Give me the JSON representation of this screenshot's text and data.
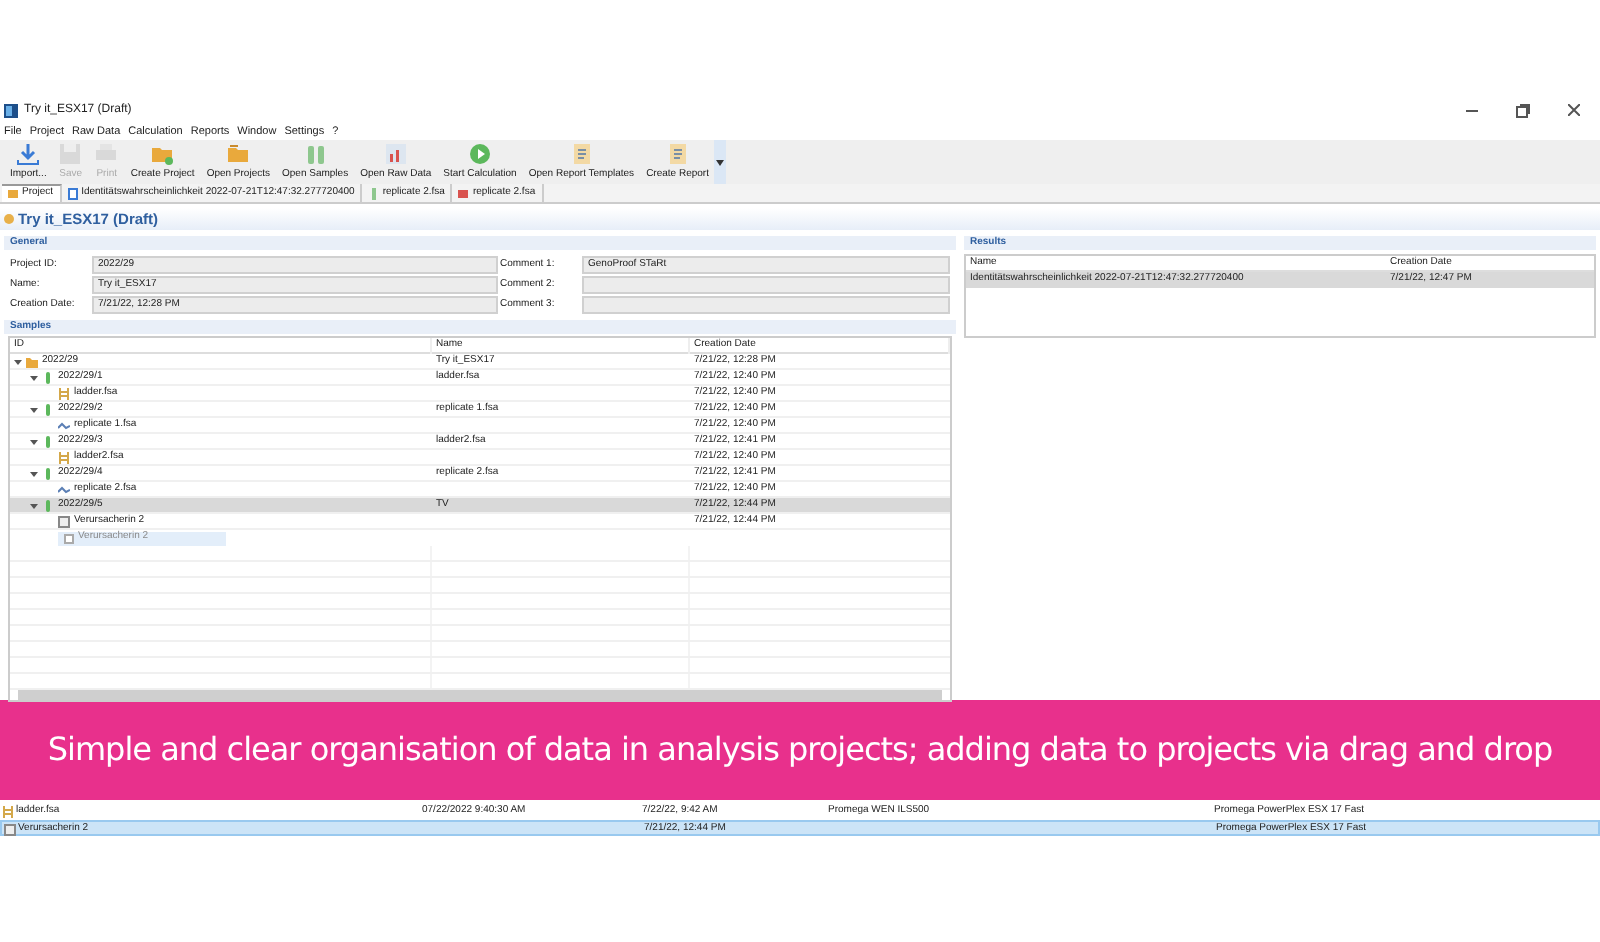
{
  "window": {
    "title": "Try it_ESX17 (Draft)"
  },
  "menu": [
    "File",
    "Project",
    "Raw Data",
    "Calculation",
    "Reports",
    "Window",
    "Settings",
    "?"
  ],
  "toolbar": [
    {
      "kind": "import",
      "label": "Import...",
      "disabled": false
    },
    {
      "kind": "save",
      "label": "Save",
      "disabled": true
    },
    {
      "kind": "print",
      "label": "Print",
      "disabled": true
    },
    {
      "kind": "create-project",
      "label": "Create Project",
      "disabled": false
    },
    {
      "kind": "open-projects",
      "label": "Open Projects",
      "disabled": false
    },
    {
      "kind": "open-samples",
      "label": "Open Samples",
      "disabled": false
    },
    {
      "kind": "raw-data",
      "label": "Open Raw Data",
      "disabled": false
    },
    {
      "kind": "start",
      "label": "Start Calculation",
      "disabled": false
    },
    {
      "kind": "report",
      "label": "Open Report Templates",
      "disabled": false
    },
    {
      "kind": "report",
      "label": "Create Report",
      "disabled": false
    }
  ],
  "editor_tabs": [
    {
      "label": "Project",
      "kind": "project",
      "selected": true
    },
    {
      "label": "Identitätswahrscheinlichkeit 2022-07-21T12:47:32.277720400",
      "kind": "result",
      "selected": false
    },
    {
      "label": "replicate 2.fsa",
      "kind": "sample",
      "selected": false
    },
    {
      "label": "replicate 2.fsa",
      "kind": "chart",
      "selected": false
    }
  ],
  "editor_title": "Try it_ESX17 (Draft)",
  "general": {
    "title": "General",
    "fields": [
      {
        "label": "Project ID:",
        "value": "2022/29"
      },
      {
        "label": "Comment 1:",
        "value": "GenoProof STaRt"
      },
      {
        "label": "Name:",
        "value": "Try it_ESX17"
      },
      {
        "label": "Comment 2:"
      },
      {
        "label": "Creation Date:",
        "value": "7/21/22, 12:28 PM"
      },
      {
        "label": "Comment 3:"
      }
    ]
  },
  "samples": {
    "title": "Samples",
    "columns": [
      "ID",
      "Name",
      "Creation Date"
    ],
    "rows": [
      {
        "id": "2022/29",
        "kind": "folder",
        "name": "Try it_ESX17",
        "date": "7/21/22, 12:28 PM",
        "expanded": true,
        "selected": false,
        "children": [
          {
            "id": "2022/29/1",
            "kind": "sample",
            "name": "ladder.fsa",
            "date": "7/21/22, 12:40 PM",
            "expanded": true,
            "selected": false,
            "children": [
              {
                "id": "ladder.fsa",
                "kind": "ladder",
                "date": "7/21/22, 12:40 PM",
                "selected": false
              }
            ]
          },
          {
            "id": "2022/29/2",
            "kind": "sample",
            "name": "replicate 1.fsa",
            "date": "7/21/22, 12:40 PM",
            "expanded": true,
            "selected": false,
            "children": [
              {
                "id": "replicate 1.fsa",
                "kind": "trace",
                "date": "7/21/22, 12:40 PM",
                "selected": false
              }
            ]
          },
          {
            "id": "2022/29/3",
            "kind": "sample",
            "name": "ladder2.fsa",
            "date": "7/21/22, 12:41 PM",
            "expanded": true,
            "selected": false,
            "children": [
              {
                "id": "ladder2.fsa",
                "kind": "ladder",
                "date": "7/21/22, 12:40 PM",
                "selected": false
              }
            ]
          },
          {
            "id": "2022/29/4",
            "kind": "sample",
            "name": "replicate 2.fsa",
            "date": "7/21/22, 12:41 PM",
            "expanded": true,
            "selected": false,
            "children": [
              {
                "id": "replicate 2.fsa",
                "kind": "trace",
                "date": "7/21/22, 12:40 PM",
                "selected": false
              }
            ]
          },
          {
            "id": "2022/29/5",
            "kind": "sample",
            "name": "TV",
            "date": "7/21/22, 12:44 PM",
            "expanded": true,
            "selected": true,
            "children": [
              {
                "id": "Verursacherin 2",
                "kind": "profile",
                "date": "7/21/22, 12:44 PM",
                "selected": false
              }
            ]
          }
        ]
      }
    ],
    "drag_ghost": "Verursacherin 2"
  },
  "results": {
    "title": "Results",
    "columns": [
      "Name",
      "Creation Date"
    ],
    "rows": [
      {
        "name": "Identitätswahrscheinlichkeit 2022-07-21T12:47:32.277720400",
        "date": "7/21/22, 12:47 PM",
        "selected": true
      }
    ]
  },
  "banner": "Simple and clear organisation of data in analysis projects; adding data to projects via drag and drop",
  "raw_data": {
    "rows": [
      {
        "kind": "ladder",
        "cells": [
          "ladder.fsa",
          "07/22/2022 9:40:30 AM",
          "7/22/22, 9:42 AM",
          "Promega WEN ILS500",
          "Promega PowerPlex ESX 17 Fast"
        ],
        "selected": false
      },
      {
        "kind": "profile",
        "cells": [
          "Verursacherin 2",
          null,
          "7/21/22, 12:44 PM",
          null,
          "Promega PowerPlex ESX 17 Fast"
        ],
        "selected": true
      }
    ]
  }
}
